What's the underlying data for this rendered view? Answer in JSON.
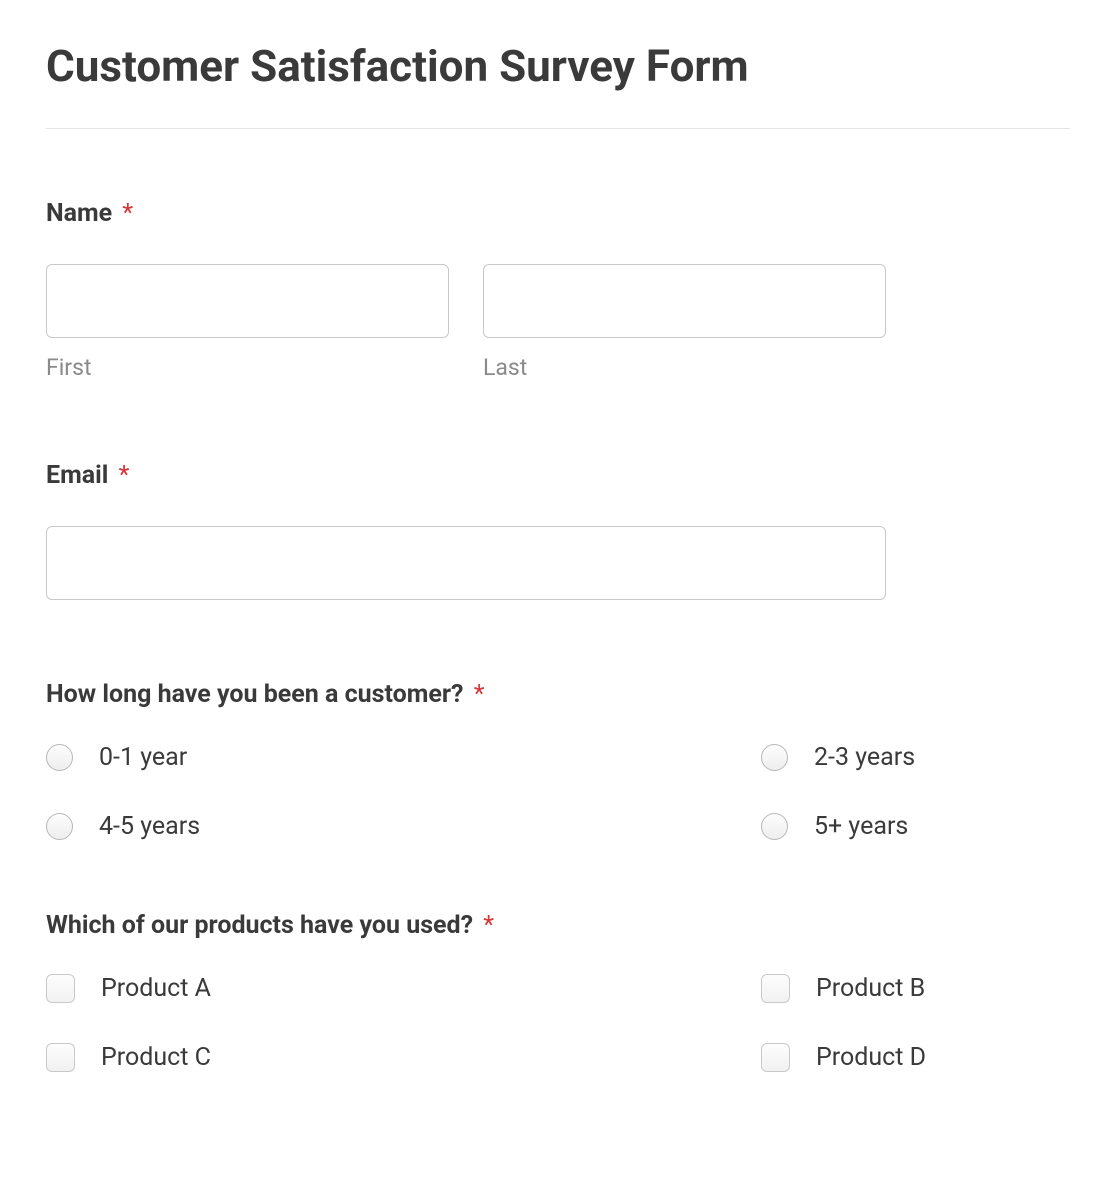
{
  "form": {
    "title": "Customer Satisfaction Survey Form",
    "required_mark": "*",
    "name": {
      "label": "Name",
      "first_sublabel": "First",
      "last_sublabel": "Last",
      "first_value": "",
      "last_value": ""
    },
    "email": {
      "label": "Email",
      "value": ""
    },
    "tenure": {
      "label": "How long have you been a customer?",
      "options": [
        "0-1 year",
        "2-3 years",
        "4-5 years",
        "5+ years"
      ]
    },
    "products": {
      "label": "Which of our products have you used?",
      "options": [
        "Product A",
        "Product B",
        "Product C",
        "Product D"
      ]
    }
  }
}
